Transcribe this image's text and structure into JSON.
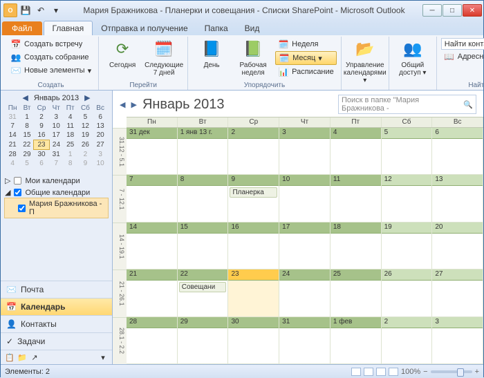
{
  "title": "Мария Бражникова - Планерки и совещания - Списки SharePoint - Microsoft Outlook",
  "tabs": {
    "file": "Файл",
    "home": "Главная",
    "sendrecv": "Отправка и получение",
    "folder": "Папка",
    "view": "Вид"
  },
  "ribbon": {
    "create": {
      "appt": "Создать встречу",
      "meeting": "Создать собрание",
      "items": "Новые элементы",
      "group": "Создать"
    },
    "nav": {
      "today": "Сегодня",
      "next7": "Следующие 7 дней",
      "group": "Перейти"
    },
    "arrange": {
      "day": "День",
      "workweek": "Рабочая неделя",
      "week": "Неделя",
      "month": "Месяц",
      "schedule": "Расписание",
      "group": "Упорядочить"
    },
    "manage": {
      "cal": "Управление календарями",
      "group": ""
    },
    "share": {
      "general": "Общий доступ",
      "group": ""
    },
    "find": {
      "contact": "Найти контакт",
      "addrbook": "Адресная книга",
      "group": "Найти"
    }
  },
  "miniCal": {
    "title": "Январь 2013",
    "dow": [
      "Пн",
      "Вт",
      "Ср",
      "Чт",
      "Пт",
      "Сб",
      "Вс"
    ],
    "rows": [
      [
        "31",
        "1",
        "2",
        "3",
        "4",
        "5",
        "6"
      ],
      [
        "7",
        "8",
        "9",
        "10",
        "11",
        "12",
        "13"
      ],
      [
        "14",
        "15",
        "16",
        "17",
        "18",
        "19",
        "20"
      ],
      [
        "21",
        "22",
        "23",
        "24",
        "25",
        "26",
        "27"
      ],
      [
        "28",
        "29",
        "30",
        "31",
        "1",
        "2",
        "3"
      ],
      [
        "4",
        "5",
        "6",
        "7",
        "8",
        "9",
        "10"
      ]
    ],
    "today": "23"
  },
  "tree": {
    "myCal": "Мои календари",
    "shared": "Общие календари",
    "person": "Мария Бражникова - П"
  },
  "navBottom": {
    "mail": "Почта",
    "calendar": "Календарь",
    "contacts": "Контакты",
    "tasks": "Задачи"
  },
  "content": {
    "title": "Январь 2013",
    "search": "Поиск в папке \"Мария Бражникова -",
    "dow": [
      "Пн",
      "Вт",
      "Ср",
      "Чт",
      "Пт",
      "Сб",
      "Вс"
    ],
    "wkLabels": [
      "31.12 - 5.1",
      "7 - 12.1",
      "14 - 19.1",
      "21 - 26.1",
      "28.1 - 2.2"
    ],
    "weeks": [
      [
        {
          "d": "31 дек"
        },
        {
          "d": "1 янв 13 г."
        },
        {
          "d": "2"
        },
        {
          "d": "3"
        },
        {
          "d": "4"
        },
        {
          "d": "5"
        },
        {
          "d": "6"
        }
      ],
      [
        {
          "d": "7"
        },
        {
          "d": "8"
        },
        {
          "d": "9",
          "ev": "Планерка"
        },
        {
          "d": "10"
        },
        {
          "d": "11"
        },
        {
          "d": "12"
        },
        {
          "d": "13"
        }
      ],
      [
        {
          "d": "14"
        },
        {
          "d": "15"
        },
        {
          "d": "16"
        },
        {
          "d": "17"
        },
        {
          "d": "18"
        },
        {
          "d": "19"
        },
        {
          "d": "20"
        }
      ],
      [
        {
          "d": "21"
        },
        {
          "d": "22",
          "ev": "Совещани"
        },
        {
          "d": "23",
          "today": true
        },
        {
          "d": "24"
        },
        {
          "d": "25"
        },
        {
          "d": "26"
        },
        {
          "d": "27"
        }
      ],
      [
        {
          "d": "28"
        },
        {
          "d": "29"
        },
        {
          "d": "30"
        },
        {
          "d": "31"
        },
        {
          "d": "1 фев"
        },
        {
          "d": "2"
        },
        {
          "d": "3"
        }
      ]
    ]
  },
  "status": {
    "items": "Элементы: 2",
    "zoom": "100%"
  }
}
